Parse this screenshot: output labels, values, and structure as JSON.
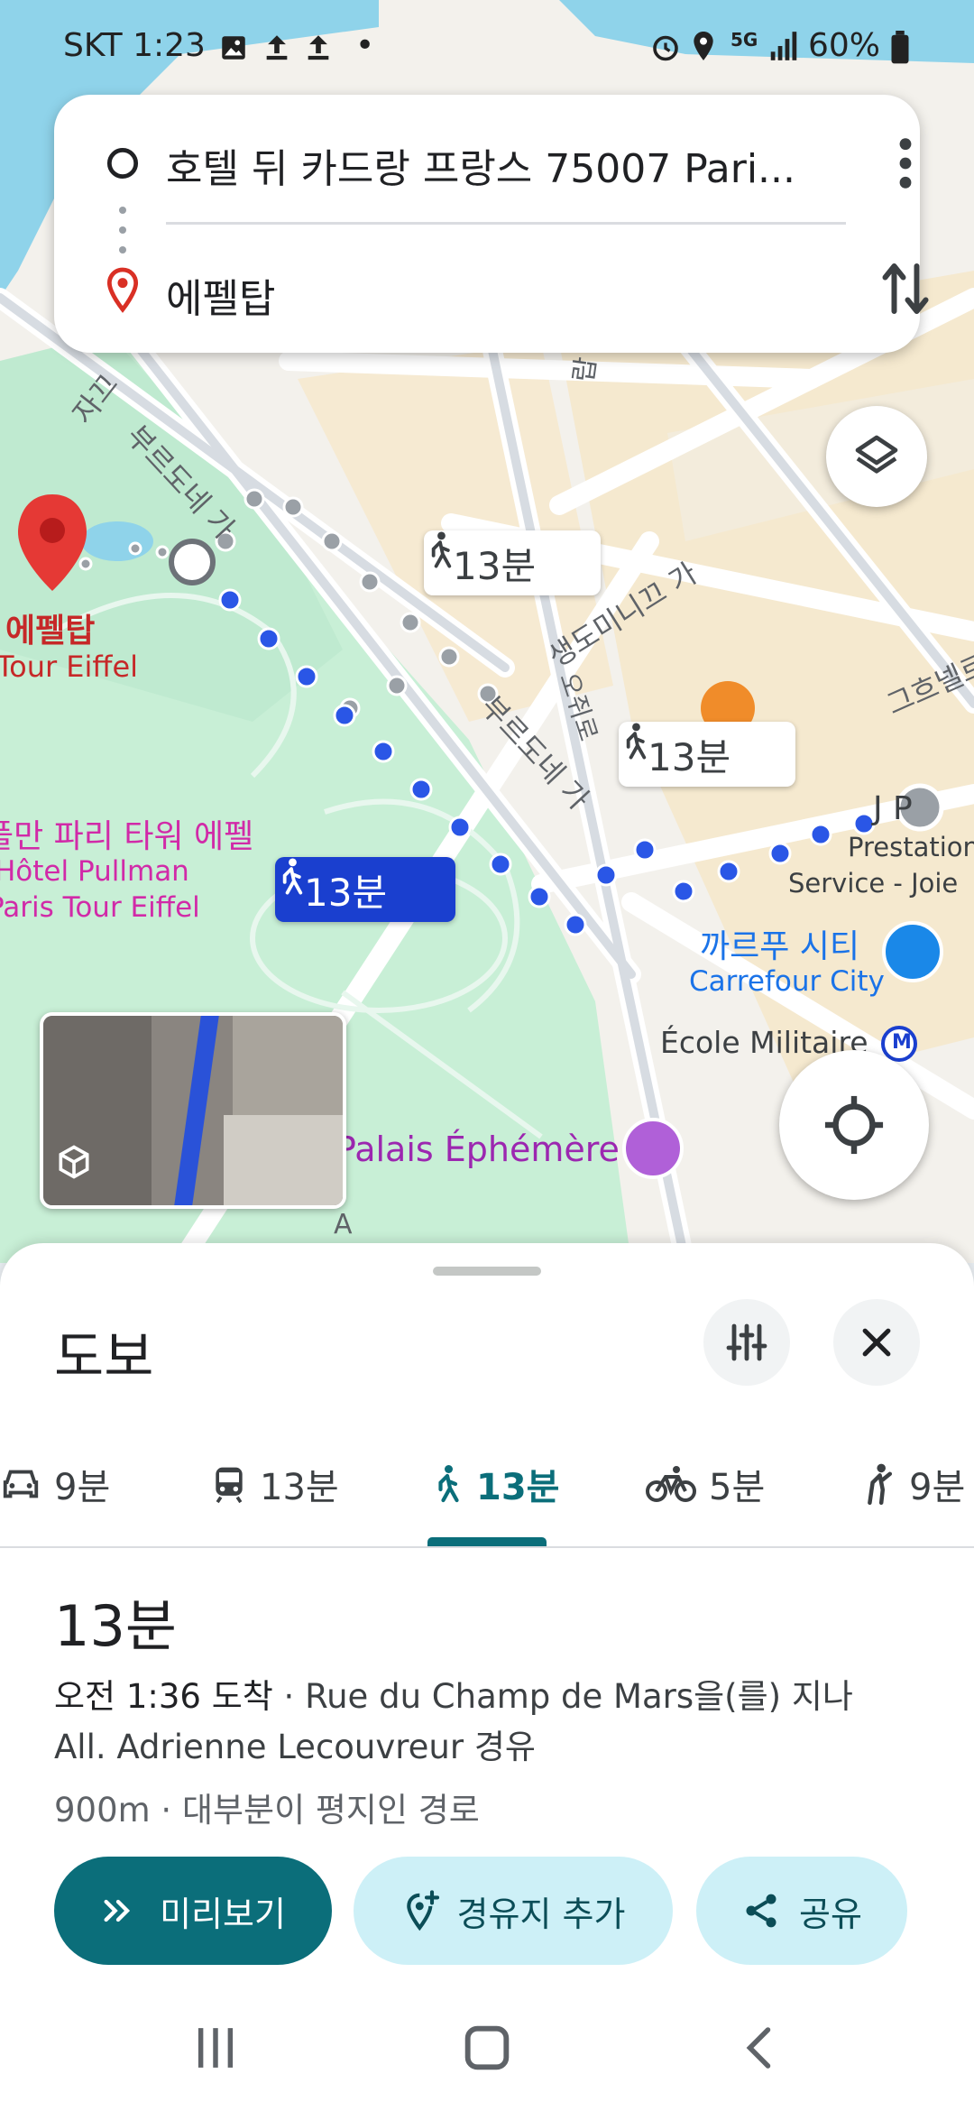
{
  "status_bar": {
    "carrier_time": "SKT 1:23",
    "dot": "•",
    "network": "5G",
    "battery": "60%"
  },
  "route_card": {
    "origin": "호텔 뒤 카드랑 프랑스 75007 Pari...",
    "destination": "에펠탑"
  },
  "map": {
    "bubbles": [
      {
        "label": "13분"
      },
      {
        "label": "13분"
      },
      {
        "label": "13분"
      }
    ],
    "street_labels": [
      "부르도네 가",
      "부르도네 가",
      "생도미니끄 가",
      "그흐넬르",
      "오쥐로",
      "랍 가",
      "자끄",
      "A"
    ],
    "places": {
      "eiffel_ko": "에펠탑",
      "eiffel_fr": "Tour Eiffel",
      "pullman_ko": "풀만 파리 타워 에펠",
      "pullman_fr1": "Hôtel Pullman",
      "pullman_fr2": "Paris Tour Eiffel",
      "carrefour_ko": "까르푸 시티",
      "carrefour_fr": "Carrefour City",
      "ecole": "École Militaire",
      "metro": "M",
      "palais": "Palais Éphémère",
      "prestation1": "Prestation",
      "prestation2": "Service - Joie",
      "jp": "J   P"
    }
  },
  "sheet": {
    "mode_title": "도보",
    "tabs": [
      {
        "icon": "car-icon",
        "label": "9분"
      },
      {
        "icon": "transit-icon",
        "label": "13분"
      },
      {
        "icon": "walk-icon",
        "label": "13분",
        "selected": true
      },
      {
        "icon": "bike-icon",
        "label": "5분"
      },
      {
        "icon": "rideshare-icon",
        "label": "9분"
      }
    ],
    "duration": "13분",
    "arrival_bold": "오전 1:36 도착",
    "via_line1": " · Rue du Champ de Mars을(를) 지나",
    "via_line2": "All. Adrienne Lecouvreur 경유",
    "distance_info": "900m · 대부분이 평지인 경로",
    "buttons": {
      "preview": "미리보기",
      "add_stop": "경유지 추가",
      "share": "공유"
    }
  },
  "colors": {
    "accent": "#0b6e7a",
    "route": "#1a4fe0",
    "park": "#c8efd6",
    "water": "#8fd3ea"
  }
}
